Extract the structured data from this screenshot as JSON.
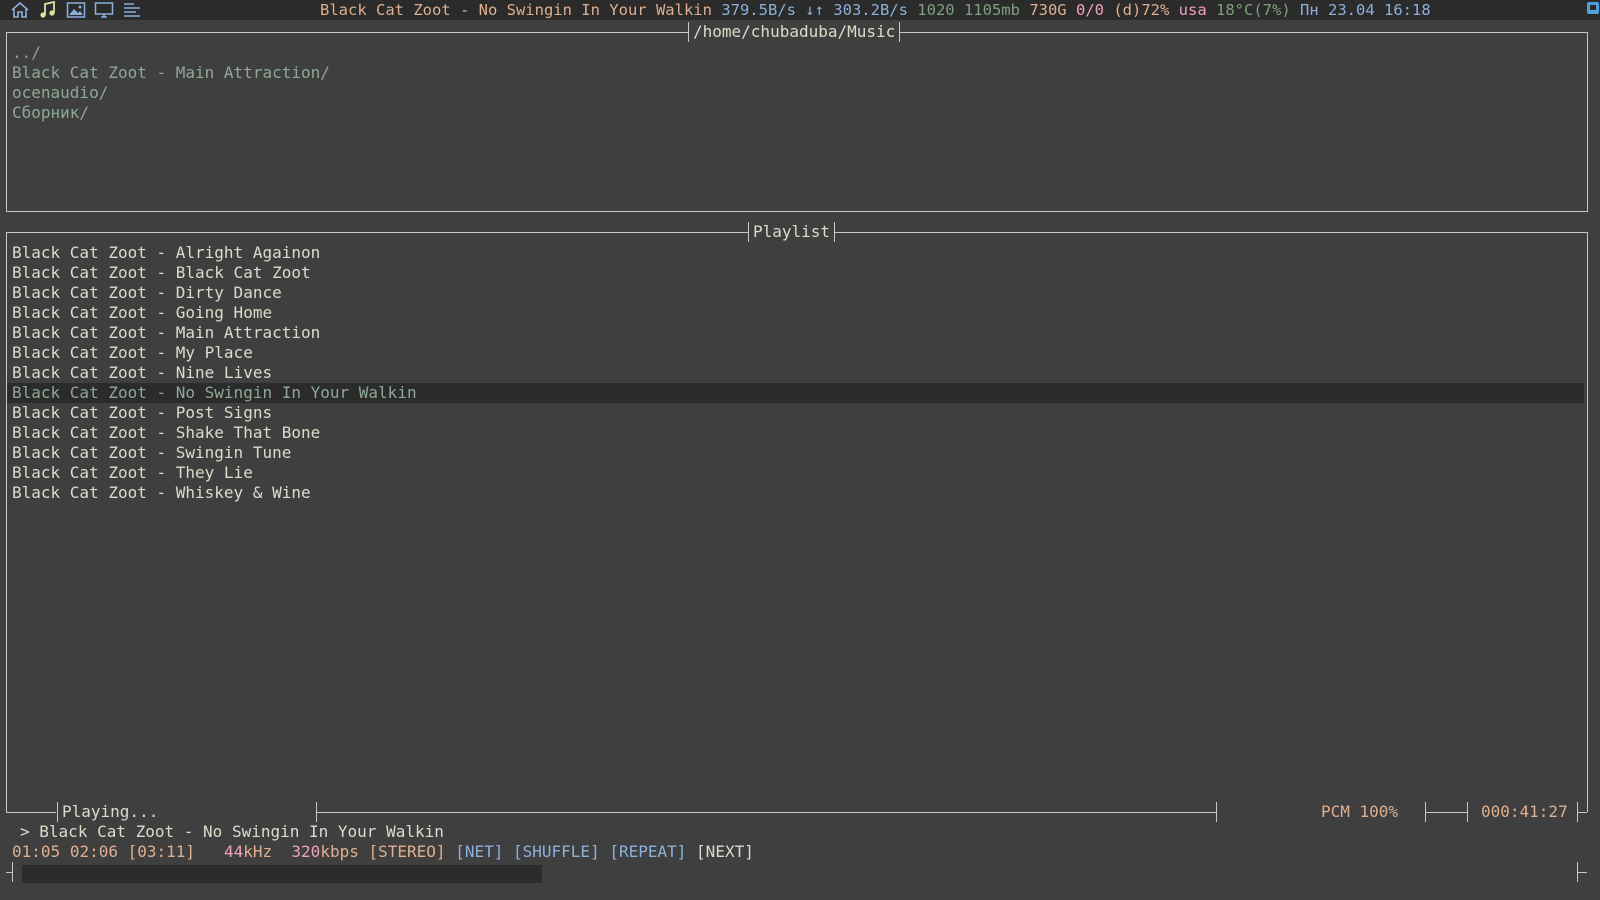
{
  "topbar": {
    "icons": [
      "home-icon",
      "music-note-icon",
      "image-icon",
      "monitor-icon",
      "menu-lines-icon"
    ],
    "now_playing": "Black Cat Zoot - No Swingin In Your Walkin",
    "net_down": "379.5B/s",
    "net_arrows": "↓↑",
    "net_up": "303.2B/s",
    "cpu_freq": "1020",
    "memory": "1105mb",
    "disk": "730G",
    "mail": "0/0",
    "battery": "(d)72%",
    "layout": "usa",
    "temp": "18°C(7%)",
    "datetime": "Пн 23.04 16:18"
  },
  "browser": {
    "title": "/home/chubaduba/Music",
    "entries": [
      "../",
      "Black Cat Zoot - Main Attraction/",
      "ocenaudio/",
      "Сборник/"
    ]
  },
  "playlist": {
    "title": "Playlist",
    "selected_index": 7,
    "tracks": [
      "Black Cat Zoot - Alright Againon",
      "Black Cat Zoot - Black Cat Zoot",
      "Black Cat Zoot - Dirty Dance",
      "Black Cat Zoot - Going Home",
      "Black Cat Zoot - Main Attraction",
      "Black Cat Zoot - My Place",
      "Black Cat Zoot - Nine Lives",
      "Black Cat Zoot - No Swingin In Your Walkin",
      "Black Cat Zoot - Post Signs",
      "Black Cat Zoot - Shake That Bone",
      "Black Cat Zoot - Swingin Tune",
      "Black Cat Zoot - They Lie",
      "Black Cat Zoot - Whiskey & Wine"
    ]
  },
  "player": {
    "state": "Playing...",
    "mixer": "PCM 100%",
    "total_time": "000:41:27",
    "current_prefix": ">",
    "current_track": "Black Cat Zoot - No Swingin In Your Walkin",
    "elapsed": "01:05",
    "remaining": "02:06",
    "duration": "[03:11]",
    "rate_value": "44",
    "rate_unit": "kHz",
    "bitrate_value": "320",
    "bitrate_unit": "kbps",
    "stereo": "[STEREO]",
    "net": "[NET]",
    "shuffle": "[SHUFFLE]",
    "repeat": "[REPEAT]",
    "next": "[NEXT]",
    "progress": 0
  },
  "colors": {
    "background": "#3f3f3f",
    "panel_dark": "#2b2b2b",
    "directory": "#8fa896",
    "text": "#dcdccc",
    "accent_blue": "#8cb0dc",
    "accent_orange": "#dfaf8f",
    "accent_pink": "#f0a0c0"
  }
}
